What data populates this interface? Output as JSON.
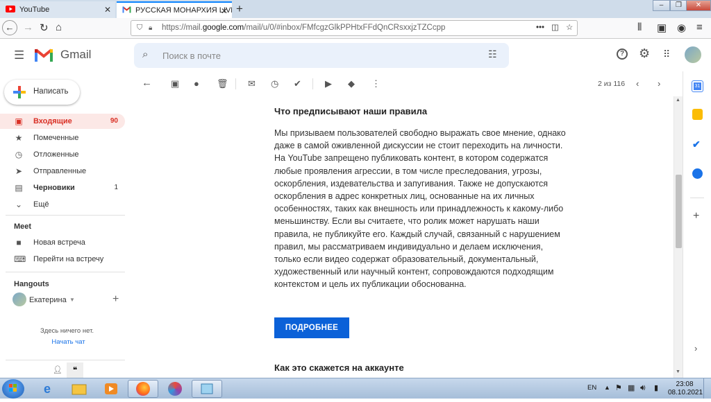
{
  "browser": {
    "tabs": [
      {
        "title": "YouTube",
        "active": false
      },
      {
        "title": "РУССКАЯ МОНАРХИЯ LIVE, ва",
        "active": true
      }
    ],
    "url_prefix": "https://mail.",
    "url_domain": "google.com",
    "url_path": "/mail/u/0/#inbox/FMfcgzGlkPPHtxFFdQnCRsxxjzTZCcpp",
    "url_dots": "•••"
  },
  "gmail": {
    "logo_text": "Gmail",
    "search_placeholder": "Поиск в почте",
    "compose_label": "Написать",
    "nav": [
      {
        "label": "Входящие",
        "count": "90",
        "icon": "inbox-icon",
        "active": true
      },
      {
        "label": "Помеченные",
        "count": "",
        "icon": "star-icon",
        "active": false
      },
      {
        "label": "Отложенные",
        "count": "",
        "icon": "clock-icon",
        "active": false
      },
      {
        "label": "Отправленные",
        "count": "",
        "icon": "send-icon",
        "active": false
      },
      {
        "label": "Черновики",
        "count": "1",
        "icon": "draft-icon",
        "active": false
      },
      {
        "label": "Ещё",
        "count": "",
        "icon": "chevron-down-icon",
        "active": false
      }
    ],
    "meet": {
      "title": "Meet",
      "items": [
        {
          "label": "Новая встреча",
          "icon": "video-icon"
        },
        {
          "label": "Перейти на встречу",
          "icon": "keyboard-icon"
        }
      ]
    },
    "hangouts": {
      "title": "Hangouts",
      "user": "Екатерина",
      "empty_text": "Здесь ничего нет.",
      "start_chat": "Начать чат"
    },
    "pagination": "2 из 116",
    "accent": "#d93025",
    "button_color": "#0b61d8"
  },
  "email": {
    "heading1": "Что предписывают наши правила",
    "body": "Мы призываем пользователей свободно выражать свое мнение, однако даже в самой оживленной дискуссии не стоит переходить на личности. На YouTube запрещено публиковать контент, в котором содержатся любые проявления агрессии, в том числе преследования, угрозы, оскорбления, издевательства и запугивания. Также не допускаются оскорбления в адрес конкретных лиц, основанные на их личных особенностях, таких как внешность или принадлежность к какому-либо меньшинству. Если вы считаете, что ролик может нарушать наши правила, не публикуйте его. Каждый случай, связанный с нарушением правил, мы рассматриваем индивидуально и делаем исключения, только если видео содержат образовательный, документальный, художественный или научный контент, сопровождаются подходящим контекстом и цель их публикации обоснованна.",
    "button": "ПОДРОБНЕЕ",
    "heading2": "Как это скажется на аккаунте"
  },
  "taskbar": {
    "lang": "EN",
    "time": "23:08",
    "date": "08.10.2021"
  }
}
